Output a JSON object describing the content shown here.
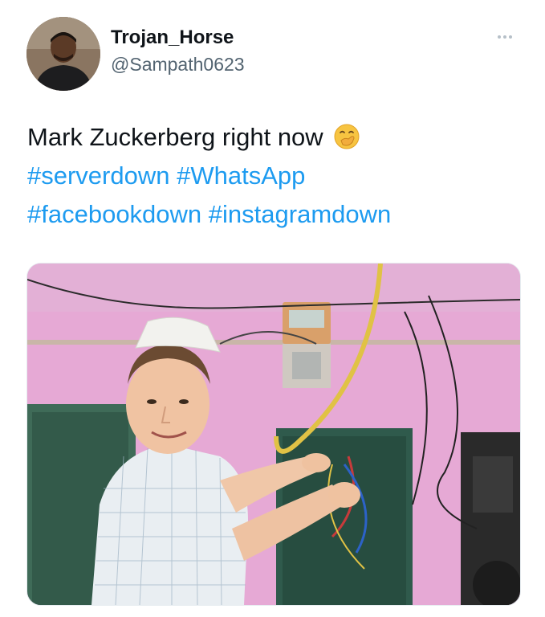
{
  "author": {
    "display_name": "Trojan_Horse",
    "handle": "@Sampath0623"
  },
  "tweet": {
    "text": "Mark Zuckerberg right now",
    "emoji": "face-with-hand-over-mouth",
    "hashtags": [
      "#serverdown",
      "#WhatsApp",
      "#facebookdown",
      "#instagramdown"
    ]
  },
  "media": {
    "description_icon": "photo",
    "colors": {
      "wall": "#e8a9d6",
      "door": "#2f5a4c",
      "shirt": "#e9eef2",
      "cap": "#f2f2ee",
      "meter": "#d9a06a"
    }
  },
  "colors": {
    "text": "#0f1419",
    "secondary": "#536471",
    "link": "#1d9bf0"
  }
}
